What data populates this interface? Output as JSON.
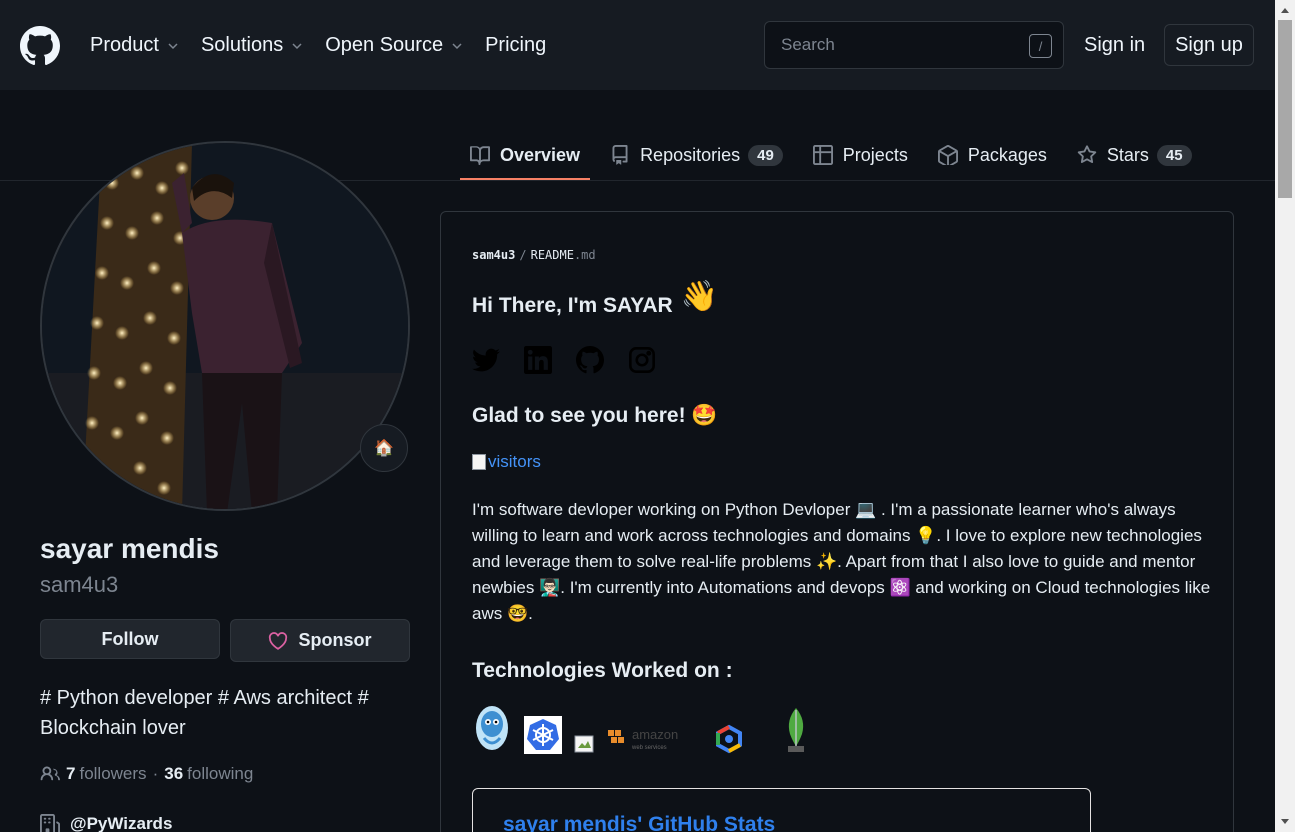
{
  "header": {
    "nav": [
      {
        "label": "Product",
        "dropdown": true
      },
      {
        "label": "Solutions",
        "dropdown": true
      },
      {
        "label": "Open Source",
        "dropdown": true
      },
      {
        "label": "Pricing",
        "dropdown": false
      }
    ],
    "search_placeholder": "Search",
    "search_shortcut": "/",
    "signin": "Sign in",
    "signup": "Sign up"
  },
  "tabs": [
    {
      "label": "Overview",
      "icon": "book-icon",
      "active": true
    },
    {
      "label": "Repositories",
      "icon": "repo-icon",
      "count": "49"
    },
    {
      "label": "Projects",
      "icon": "table-icon"
    },
    {
      "label": "Packages",
      "icon": "package-icon"
    },
    {
      "label": "Stars",
      "icon": "star-icon",
      "count": "45"
    }
  ],
  "profile": {
    "status_emoji": "🏠",
    "fullname": "sayar mendis",
    "login": "sam4u3",
    "follow_label": "Follow",
    "sponsor_label": "Sponsor",
    "bio": "# Python developer # Aws architect # Blockchain lover",
    "followers_count": "7",
    "followers_label": "followers",
    "separator": "·",
    "following_count": "36",
    "following_label": "following",
    "org": "@PyWizards"
  },
  "readme": {
    "path_user": "sam4u3",
    "path_sep": "/",
    "path_file": "README",
    "path_ext": ".md",
    "greeting": "Hi There, I'm SAYAR",
    "greeting_emoji": "👋",
    "socials": [
      "twitter-icon",
      "linkedin-icon",
      "github-icon",
      "instagram-icon"
    ],
    "glad": "Glad to see you here!",
    "glad_emoji": "🤩",
    "visitors_alt": "visitors",
    "paragraph": "I'm software devloper working on Python Devloper 💻 . I'm a passionate learner who's always willing to learn and work across technologies and domains 💡. I love to explore new technologies and leverage them to solve real-life problems ✨. Apart from that I also love to guide and mentor newbies 👨🏻‍🏫. I'm currently into Automations and devops ⚛️ and working on Cloud technologies like aws 🤓.",
    "tech_heading": "Technologies Worked on :",
    "tech_icons": [
      "kubernetes-icon",
      "placeholder-icon",
      "aws-icon",
      "gcp-icon",
      "mongodb-icon"
    ],
    "aws_text": "amazon",
    "aws_sub": "web services",
    "stats_title": "sayar mendis' GitHub Stats"
  }
}
